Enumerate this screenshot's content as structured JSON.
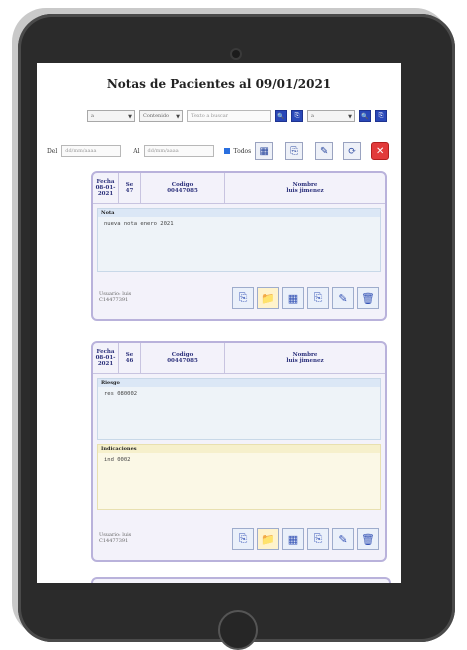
{
  "page": {
    "title": "Notas de Pacientes al 09/01/2021"
  },
  "filters": {
    "select1": "a",
    "select2": "Contenido",
    "search_placeholder": "Texto a buscar",
    "select3": "a",
    "date_from_label": "Del",
    "date_from_placeholder": "dd/mm/aaaa",
    "date_to_label": "Al",
    "date_to_placeholder": "dd/mm/aaaa",
    "all_label": "Todos"
  },
  "icons": {
    "search": "🔍",
    "grid": "▦",
    "copy": "⎘",
    "edit": "✎",
    "refresh": "⟳",
    "close": "✕",
    "folder": "📁",
    "delete": "🗑"
  },
  "notes": [
    {
      "fecha": "08-01-2021",
      "se": "47",
      "codigo": "00447085",
      "nombre": "luis jimenez",
      "sections": [
        {
          "label": "Nota",
          "text": "nueva nota enero 2021"
        }
      ],
      "usuario": "Usuario: luis",
      "usuario_id": "C14477391"
    },
    {
      "fecha": "08-01-2021",
      "se": "46",
      "codigo": "00447085",
      "nombre": "luis jimenez",
      "sections": [
        {
          "label": "Riesgo",
          "text": "res 080002"
        },
        {
          "label": "Indicaciones",
          "text": "ind 0002"
        }
      ],
      "usuario": "Usuario: luis",
      "usuario_id": "C14477391"
    }
  ],
  "headers": {
    "fecha": "Fecha",
    "se": "Se",
    "codigo": "Codigo",
    "nombre": "Nombre"
  }
}
